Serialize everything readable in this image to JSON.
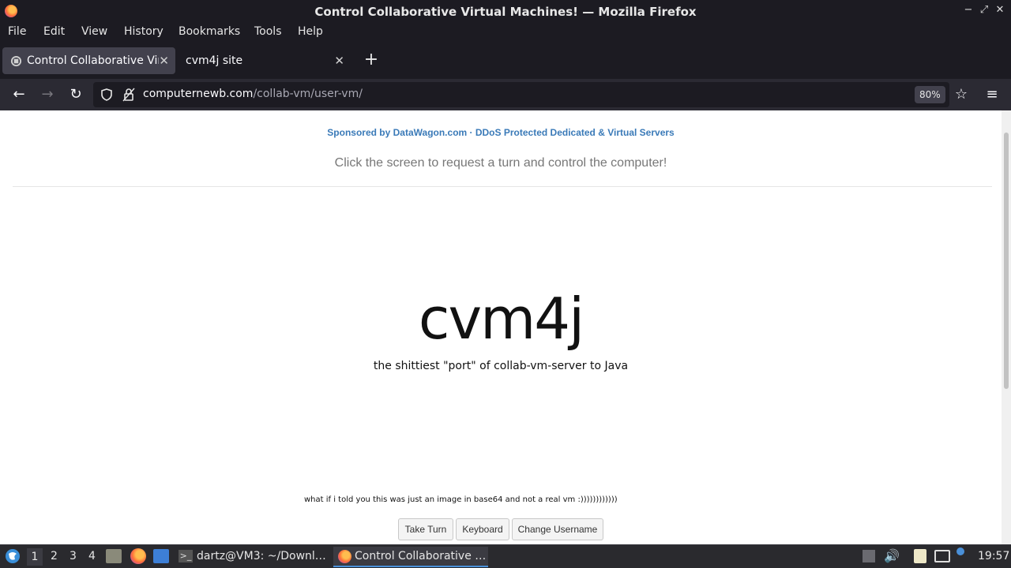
{
  "window": {
    "title": "Control Collaborative Virtual Machines! — Mozilla Firefox"
  },
  "menu": [
    "File",
    "Edit",
    "View",
    "History",
    "Bookmarks",
    "Tools",
    "Help"
  ],
  "tabs": [
    {
      "label": "Control Collaborative Virtual Machines!",
      "active": true
    },
    {
      "label": "cvm4j site",
      "active": false
    }
  ],
  "url": {
    "domain": "computernewb.com",
    "path": "/collab-vm/user-vm/",
    "zoom": "80%"
  },
  "page": {
    "sponsor": "Sponsored by DataWagon.com · DDoS Protected Dedicated & Virtual Servers",
    "instructions": "Click the screen to request a turn and control the computer!",
    "vm_title": "cvm4j",
    "vm_subtitle": "the shittiest \"port\" of collab-vm-server to Java",
    "vm_note": "what if i told you this was just an image in base64 and not a real vm :))))))))))))",
    "buttons": {
      "take_turn": "Take Turn",
      "keyboard": "Keyboard",
      "change_username": "Change Username"
    }
  },
  "taskbar": {
    "workspaces": [
      "1",
      "2",
      "3",
      "4"
    ],
    "tasks": [
      {
        "label": "dartz@VM3: ~/Downl…"
      },
      {
        "label": "Control Collaborative …"
      }
    ],
    "clock": "19:57"
  },
  "colors": {
    "accent": "#4a90d9",
    "sponsor": "#3a7ab8"
  }
}
